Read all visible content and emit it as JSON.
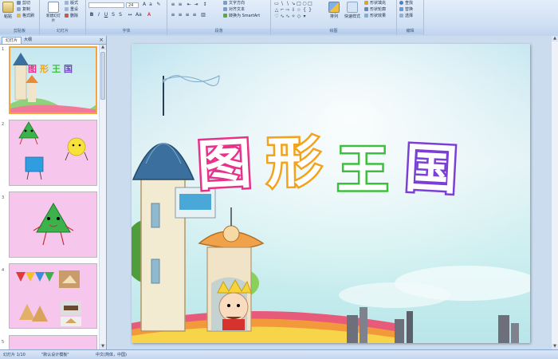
{
  "ribbon": {
    "clipboard": {
      "label": "剪贴板",
      "paste": "粘贴",
      "cut": "剪切",
      "copy": "复制",
      "format_painter": "格式刷"
    },
    "slides": {
      "label": "幻灯片",
      "new_slide": "新建幻灯片",
      "layout": "版式",
      "reset": "重设",
      "delete": "删除"
    },
    "font": {
      "label": "字体",
      "font_size": "24"
    },
    "paragraph": {
      "label": "段落",
      "text_direction": "文字方向",
      "align_text": "对齐文本",
      "smartart": "转换为 SmartArt"
    },
    "drawing": {
      "label": "绘图",
      "arrange": "排列",
      "quick_styles": "快速样式",
      "shape_fill": "形状填充",
      "shape_outline": "形状轮廓",
      "shape_effects": "形状效果"
    },
    "editing": {
      "label": "编辑",
      "find": "查找",
      "replace": "替换",
      "select": "选择"
    }
  },
  "panel": {
    "tabs": [
      "幻灯片",
      "大纲"
    ],
    "close": "×",
    "slide_numbers": [
      "1",
      "2",
      "3",
      "4",
      "5"
    ]
  },
  "slide": {
    "title_chars": [
      "图",
      "形",
      "王",
      "国"
    ]
  },
  "status": {
    "slide_info": "幻灯片 1/10",
    "theme": "\"默认设计模板\"",
    "language": "中文(简体，中国)"
  },
  "colors": {
    "accent": "#f3a43b",
    "ribbon_top": "#e4eefb",
    "title_char_colors": [
      "#e8318a",
      "#f2a21b",
      "#3cbf3c",
      "#7b3fd6"
    ]
  },
  "icons": [
    "paste-icon",
    "cut-icon",
    "copy-icon",
    "format-painter-icon",
    "new-slide-icon",
    "bold-icon",
    "italic-icon",
    "underline-icon",
    "arrange-icon",
    "find-icon",
    "replace-icon",
    "select-icon"
  ]
}
